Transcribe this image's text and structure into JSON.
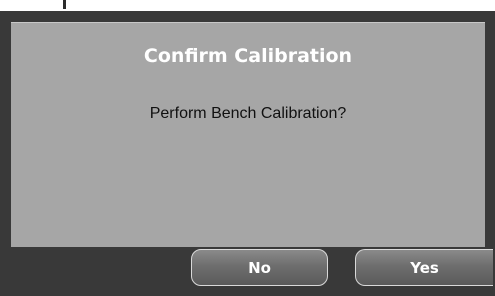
{
  "dialog": {
    "title": "Confirm Calibration",
    "message": "Perform Bench Calibration?",
    "buttons": {
      "no_label": "No",
      "yes_label": "Yes"
    }
  },
  "colors": {
    "frame": "#393939",
    "body": "#a6a6a6",
    "title_text": "#ffffff",
    "message_text": "#111111",
    "button_fill": "#6e6e6e",
    "button_border": "#d9d9d9"
  }
}
